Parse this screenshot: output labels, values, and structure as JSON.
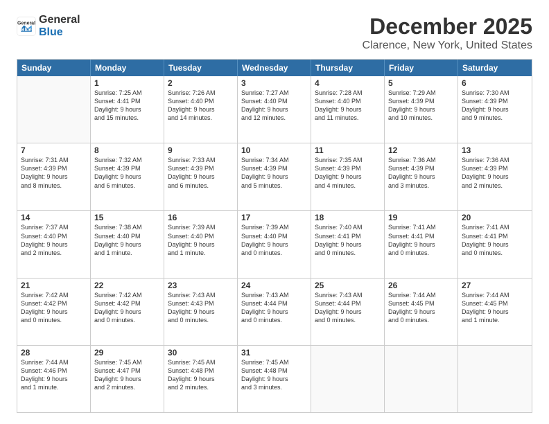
{
  "logo": {
    "general": "General",
    "blue": "Blue"
  },
  "header": {
    "title": "December 2025",
    "subtitle": "Clarence, New York, United States"
  },
  "calendar": {
    "days": [
      "Sunday",
      "Monday",
      "Tuesday",
      "Wednesday",
      "Thursday",
      "Friday",
      "Saturday"
    ],
    "rows": [
      [
        {
          "day": "",
          "empty": true
        },
        {
          "day": "1",
          "line1": "Sunrise: 7:25 AM",
          "line2": "Sunset: 4:41 PM",
          "line3": "Daylight: 9 hours",
          "line4": "and 15 minutes."
        },
        {
          "day": "2",
          "line1": "Sunrise: 7:26 AM",
          "line2": "Sunset: 4:40 PM",
          "line3": "Daylight: 9 hours",
          "line4": "and 14 minutes."
        },
        {
          "day": "3",
          "line1": "Sunrise: 7:27 AM",
          "line2": "Sunset: 4:40 PM",
          "line3": "Daylight: 9 hours",
          "line4": "and 12 minutes."
        },
        {
          "day": "4",
          "line1": "Sunrise: 7:28 AM",
          "line2": "Sunset: 4:40 PM",
          "line3": "Daylight: 9 hours",
          "line4": "and 11 minutes."
        },
        {
          "day": "5",
          "line1": "Sunrise: 7:29 AM",
          "line2": "Sunset: 4:39 PM",
          "line3": "Daylight: 9 hours",
          "line4": "and 10 minutes."
        },
        {
          "day": "6",
          "line1": "Sunrise: 7:30 AM",
          "line2": "Sunset: 4:39 PM",
          "line3": "Daylight: 9 hours",
          "line4": "and 9 minutes."
        }
      ],
      [
        {
          "day": "7",
          "line1": "Sunrise: 7:31 AM",
          "line2": "Sunset: 4:39 PM",
          "line3": "Daylight: 9 hours",
          "line4": "and 8 minutes."
        },
        {
          "day": "8",
          "line1": "Sunrise: 7:32 AM",
          "line2": "Sunset: 4:39 PM",
          "line3": "Daylight: 9 hours",
          "line4": "and 6 minutes."
        },
        {
          "day": "9",
          "line1": "Sunrise: 7:33 AM",
          "line2": "Sunset: 4:39 PM",
          "line3": "Daylight: 9 hours",
          "line4": "and 6 minutes."
        },
        {
          "day": "10",
          "line1": "Sunrise: 7:34 AM",
          "line2": "Sunset: 4:39 PM",
          "line3": "Daylight: 9 hours",
          "line4": "and 5 minutes."
        },
        {
          "day": "11",
          "line1": "Sunrise: 7:35 AM",
          "line2": "Sunset: 4:39 PM",
          "line3": "Daylight: 9 hours",
          "line4": "and 4 minutes."
        },
        {
          "day": "12",
          "line1": "Sunrise: 7:36 AM",
          "line2": "Sunset: 4:39 PM",
          "line3": "Daylight: 9 hours",
          "line4": "and 3 minutes."
        },
        {
          "day": "13",
          "line1": "Sunrise: 7:36 AM",
          "line2": "Sunset: 4:39 PM",
          "line3": "Daylight: 9 hours",
          "line4": "and 2 minutes."
        }
      ],
      [
        {
          "day": "14",
          "line1": "Sunrise: 7:37 AM",
          "line2": "Sunset: 4:40 PM",
          "line3": "Daylight: 9 hours",
          "line4": "and 2 minutes."
        },
        {
          "day": "15",
          "line1": "Sunrise: 7:38 AM",
          "line2": "Sunset: 4:40 PM",
          "line3": "Daylight: 9 hours",
          "line4": "and 1 minute."
        },
        {
          "day": "16",
          "line1": "Sunrise: 7:39 AM",
          "line2": "Sunset: 4:40 PM",
          "line3": "Daylight: 9 hours",
          "line4": "and 1 minute."
        },
        {
          "day": "17",
          "line1": "Sunrise: 7:39 AM",
          "line2": "Sunset: 4:40 PM",
          "line3": "Daylight: 9 hours",
          "line4": "and 0 minutes."
        },
        {
          "day": "18",
          "line1": "Sunrise: 7:40 AM",
          "line2": "Sunset: 4:41 PM",
          "line3": "Daylight: 9 hours",
          "line4": "and 0 minutes."
        },
        {
          "day": "19",
          "line1": "Sunrise: 7:41 AM",
          "line2": "Sunset: 4:41 PM",
          "line3": "Daylight: 9 hours",
          "line4": "and 0 minutes."
        },
        {
          "day": "20",
          "line1": "Sunrise: 7:41 AM",
          "line2": "Sunset: 4:41 PM",
          "line3": "Daylight: 9 hours",
          "line4": "and 0 minutes."
        }
      ],
      [
        {
          "day": "21",
          "line1": "Sunrise: 7:42 AM",
          "line2": "Sunset: 4:42 PM",
          "line3": "Daylight: 9 hours",
          "line4": "and 0 minutes."
        },
        {
          "day": "22",
          "line1": "Sunrise: 7:42 AM",
          "line2": "Sunset: 4:42 PM",
          "line3": "Daylight: 9 hours",
          "line4": "and 0 minutes."
        },
        {
          "day": "23",
          "line1": "Sunrise: 7:43 AM",
          "line2": "Sunset: 4:43 PM",
          "line3": "Daylight: 9 hours",
          "line4": "and 0 minutes."
        },
        {
          "day": "24",
          "line1": "Sunrise: 7:43 AM",
          "line2": "Sunset: 4:44 PM",
          "line3": "Daylight: 9 hours",
          "line4": "and 0 minutes."
        },
        {
          "day": "25",
          "line1": "Sunrise: 7:43 AM",
          "line2": "Sunset: 4:44 PM",
          "line3": "Daylight: 9 hours",
          "line4": "and 0 minutes."
        },
        {
          "day": "26",
          "line1": "Sunrise: 7:44 AM",
          "line2": "Sunset: 4:45 PM",
          "line3": "Daylight: 9 hours",
          "line4": "and 0 minutes."
        },
        {
          "day": "27",
          "line1": "Sunrise: 7:44 AM",
          "line2": "Sunset: 4:45 PM",
          "line3": "Daylight: 9 hours",
          "line4": "and 1 minute."
        }
      ],
      [
        {
          "day": "28",
          "line1": "Sunrise: 7:44 AM",
          "line2": "Sunset: 4:46 PM",
          "line3": "Daylight: 9 hours",
          "line4": "and 1 minute."
        },
        {
          "day": "29",
          "line1": "Sunrise: 7:45 AM",
          "line2": "Sunset: 4:47 PM",
          "line3": "Daylight: 9 hours",
          "line4": "and 2 minutes."
        },
        {
          "day": "30",
          "line1": "Sunrise: 7:45 AM",
          "line2": "Sunset: 4:48 PM",
          "line3": "Daylight: 9 hours",
          "line4": "and 2 minutes."
        },
        {
          "day": "31",
          "line1": "Sunrise: 7:45 AM",
          "line2": "Sunset: 4:48 PM",
          "line3": "Daylight: 9 hours",
          "line4": "and 3 minutes."
        },
        {
          "day": "",
          "empty": true
        },
        {
          "day": "",
          "empty": true
        },
        {
          "day": "",
          "empty": true
        }
      ]
    ]
  }
}
